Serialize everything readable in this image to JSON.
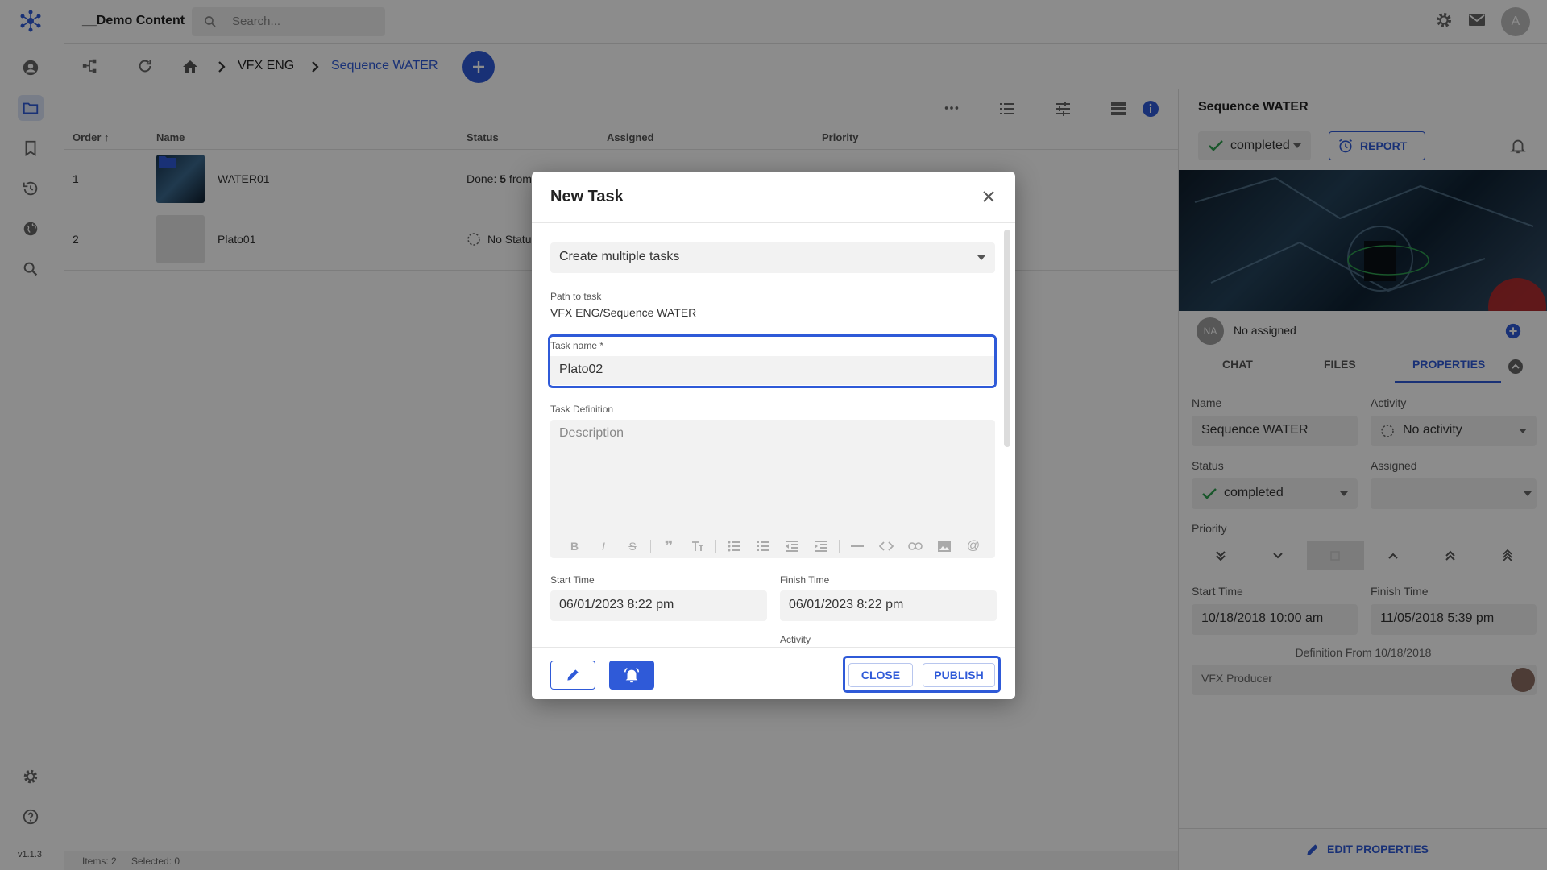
{
  "app": {
    "project_title": "__Demo Content",
    "search_placeholder": "Search...",
    "avatar_initial": "A",
    "version": "v1.1.3",
    "accent_color": "#2f5ad8"
  },
  "breadcrumb": {
    "items": [
      "VFX ENG",
      "Sequence WATER"
    ]
  },
  "table": {
    "headers": [
      "Order",
      "Name",
      "Status",
      "Assigned",
      "Priority"
    ],
    "rows": [
      {
        "order": "1",
        "name": "WATER01",
        "status_prefix": "Done: ",
        "status_bold": "5",
        "status_suffix": " from"
      },
      {
        "order": "2",
        "name": "Plato01",
        "status_text": "No Statu"
      }
    ]
  },
  "status_bar": {
    "items": "Items: 2",
    "selected": "Selected: 0"
  },
  "right_panel": {
    "title": "Sequence WATER",
    "status": "completed",
    "report_label": "REPORT",
    "assigned_initials": "NA",
    "assigned_text": "No assigned",
    "tabs": [
      "CHAT",
      "FILES",
      "PROPERTIES"
    ],
    "active_tab": "PROPERTIES",
    "labels": {
      "name": "Name",
      "activity": "Activity",
      "status": "Status",
      "assigned": "Assigned",
      "priority": "Priority",
      "start_time": "Start Time",
      "finish_time": "Finish Time"
    },
    "values": {
      "name": "Sequence WATER",
      "activity": "No activity",
      "status": "completed",
      "start_time": "10/18/2018 10:00 am",
      "finish_time": "11/05/2018 5:39 pm"
    },
    "definition_from": "Definition From 10/18/2018",
    "definition_user": "VFX Producer",
    "edit_properties": "EDIT PROPERTIES"
  },
  "modal": {
    "title": "New Task",
    "mode_select": "Create multiple tasks",
    "path_label": "Path to task",
    "path_value": "VFX ENG/Sequence WATER",
    "task_name_label": "Task name *",
    "task_name_value": "Plato02",
    "definition_label": "Task Definition",
    "description_placeholder": "Description",
    "start_time_label": "Start Time",
    "start_time_value": "06/01/2023 8:22 pm",
    "finish_time_label": "Finish Time",
    "finish_time_value": "06/01/2023 8:22 pm",
    "activity_label": "Activity",
    "close_label": "CLOSE",
    "publish_label": "PUBLISH"
  }
}
